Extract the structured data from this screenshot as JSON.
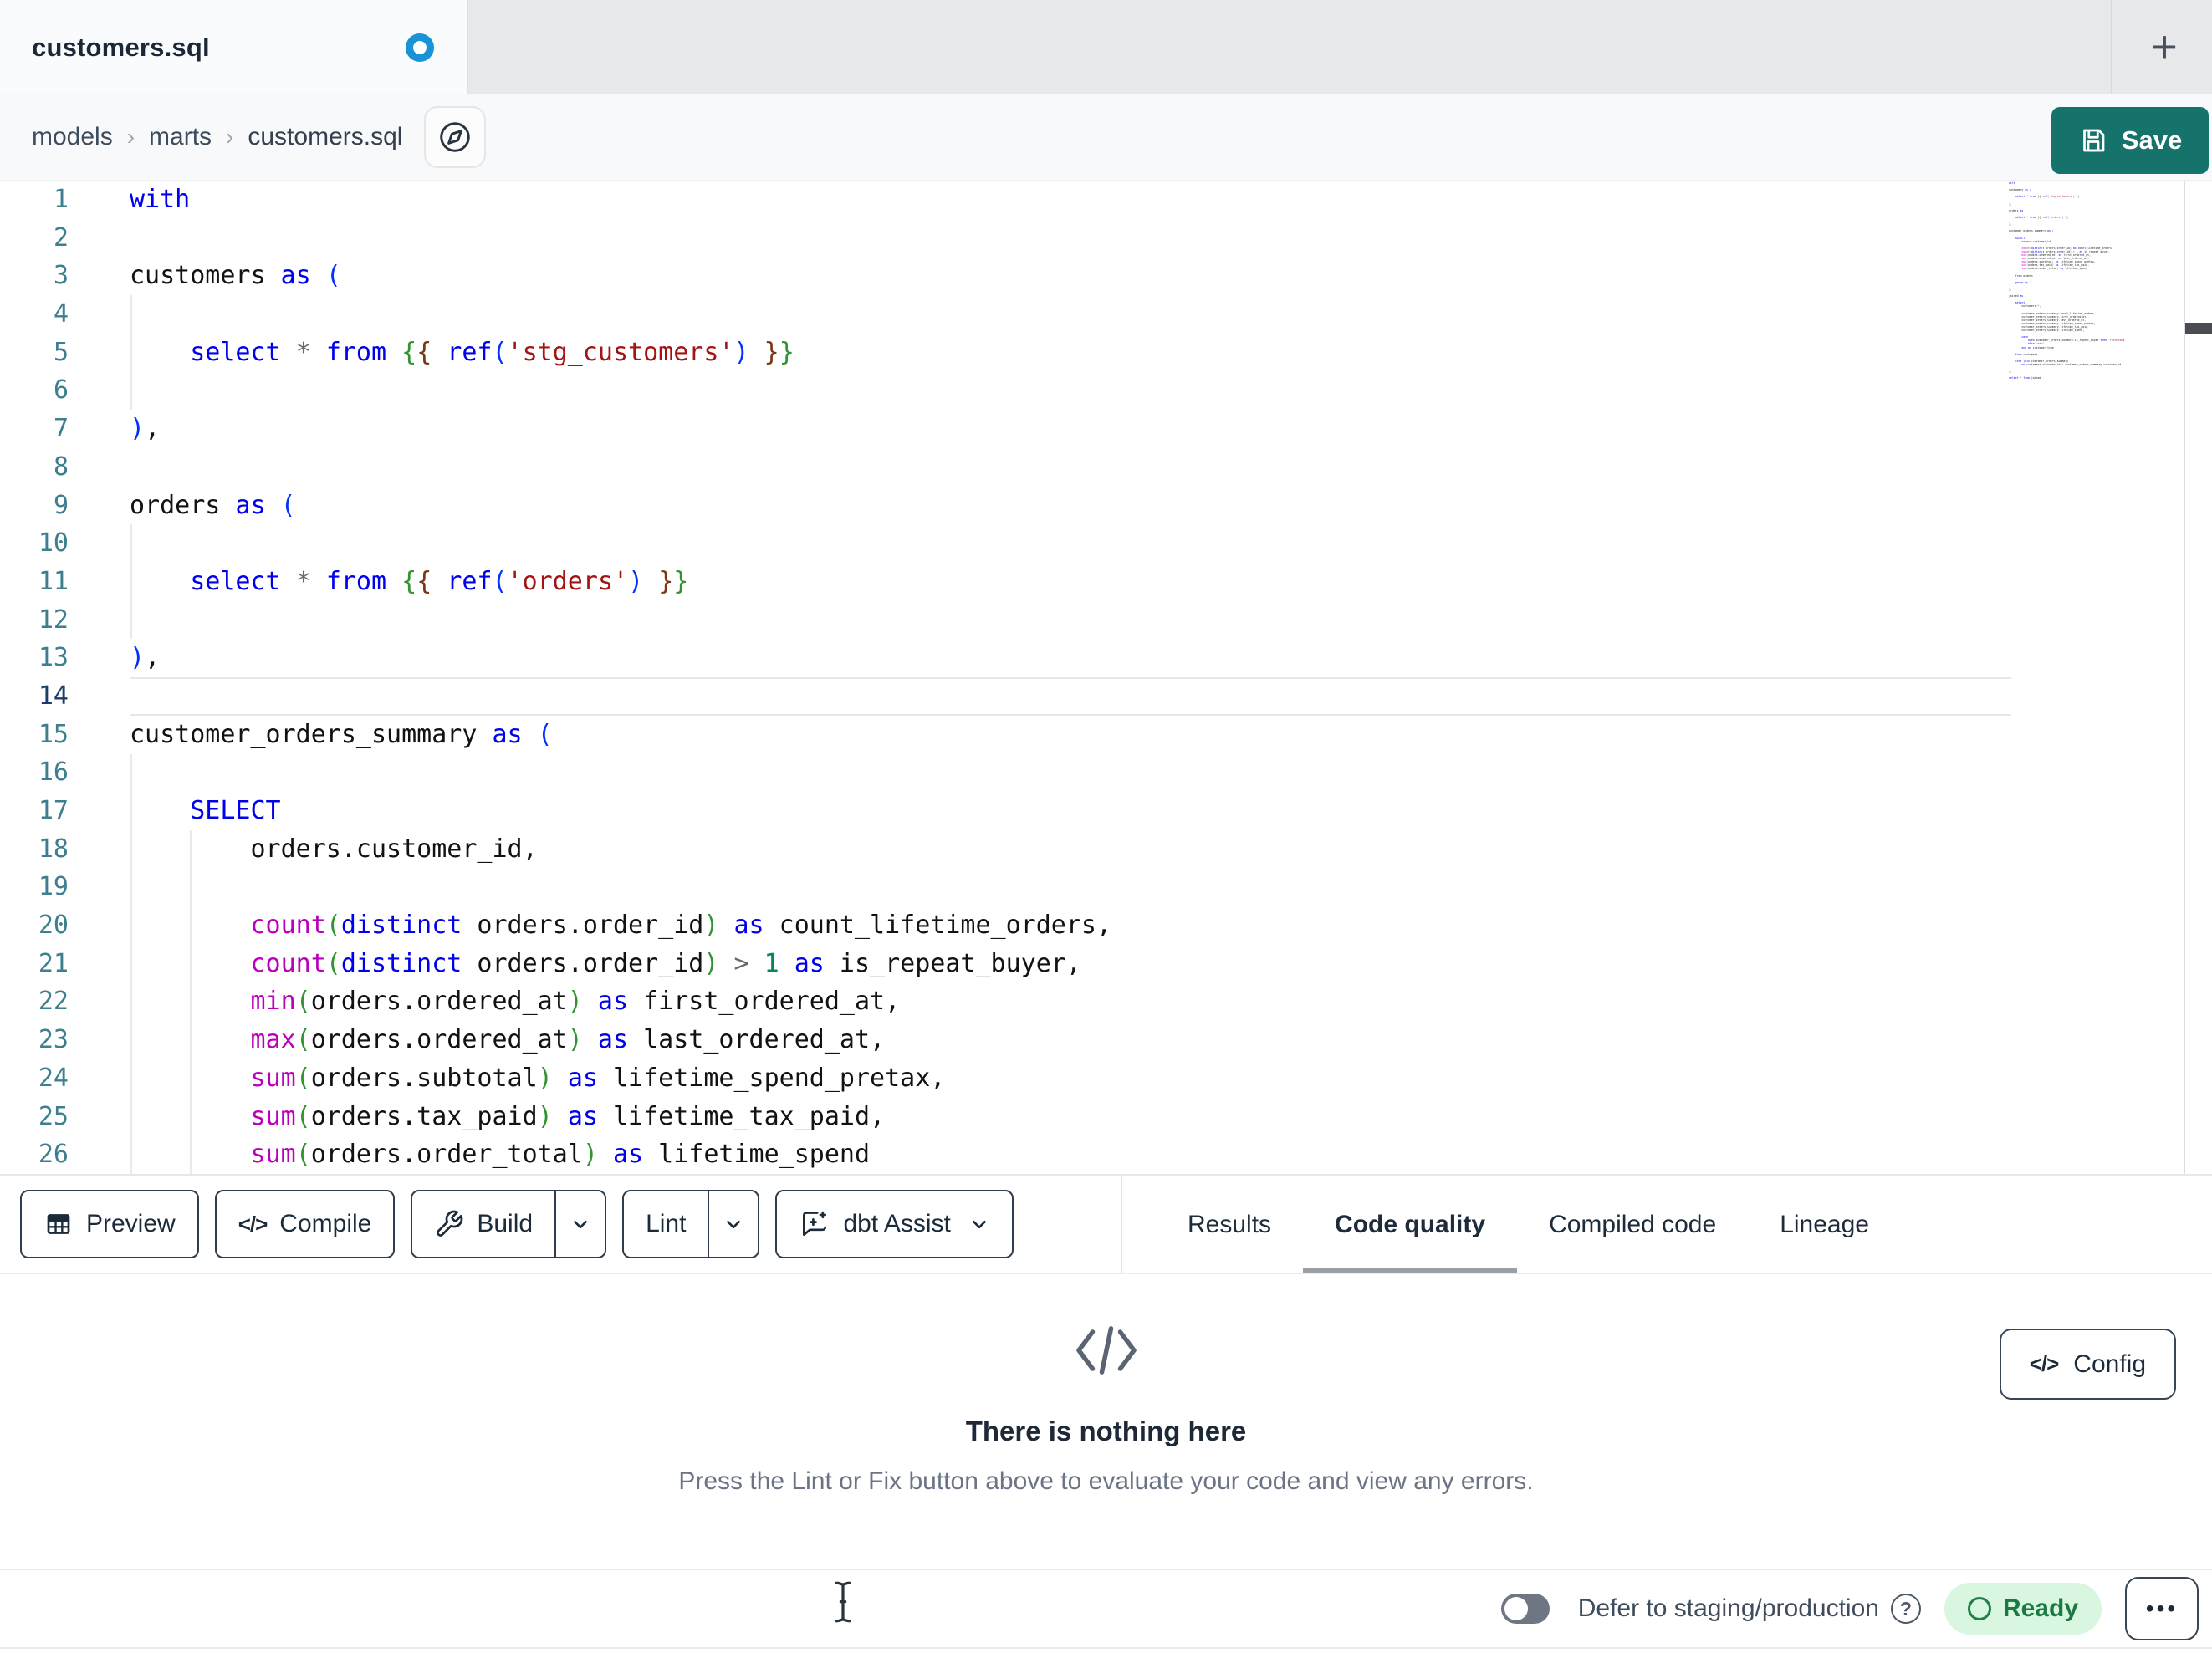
{
  "tab_bar": {
    "active_tab_label": "customers.sql",
    "new_tab_glyph": "+",
    "unsaved_indicator": "unsaved-changes"
  },
  "breadcrumb": {
    "items": [
      "models",
      "marts",
      "customers.sql"
    ],
    "separator": "›"
  },
  "save_button": {
    "label": "Save"
  },
  "editor": {
    "language": "sql",
    "active_line": 14,
    "code_lines": [
      "with",
      "",
      "customers as (",
      "",
      "    select * from {{ ref('stg_customers') }}",
      "",
      "),",
      "",
      "orders as (",
      "",
      "    select * from {{ ref('orders') }}",
      "",
      "),",
      "",
      "customer_orders_summary as (",
      "",
      "    SELECT",
      "        orders.customer_id,",
      "",
      "        count(distinct orders.order_id) as count_lifetime_orders,",
      "        count(distinct orders.order_id) > 1 as is_repeat_buyer,",
      "        min(orders.ordered_at) as first_ordered_at,",
      "        max(orders.ordered_at) as last_ordered_at,",
      "        sum(orders.subtotal) as lifetime_spend_pretax,",
      "        sum(orders.tax_paid) as lifetime_tax_paid,",
      "        sum(orders.order_total) as lifetime_spend"
    ],
    "minimap_lines": [
      "with",
      "",
      "customers as (",
      "",
      "    select * from {{ ref('stg_customers') }}",
      "",
      "),",
      "",
      "orders as (",
      "",
      "    select * from {{ ref('orders') }}",
      "",
      "),",
      "",
      "customer_orders_summary as (",
      "",
      "    SELECT",
      "        orders.customer_id,",
      "",
      "        count(distinct orders.order_id) as count_lifetime_orders,",
      "        count(distinct orders.order_id) > 1 as is_repeat_buyer,",
      "        min(orders.ordered_at) as first_ordered_at,",
      "        max(orders.ordered_at) as last_ordered_at,",
      "        sum(orders.subtotal) as lifetime_spend_pretax,",
      "        sum(orders.tax_paid) as lifetime_tax_paid,",
      "        sum(orders.order_total) as lifetime_spend",
      "",
      "    from orders",
      "",
      "    group by 1",
      "",
      "),",
      "",
      "joined as (",
      "",
      "    select",
      "        customers.*,",
      "",
      "        customer_orders_summary.count_lifetime_orders,",
      "        customer_orders_summary.first_ordered_at,",
      "        customer_orders_summary.last_ordered_at,",
      "        customer_orders_summary.lifetime_spend_pretax,",
      "        customer_orders_summary.lifetime_tax_paid,",
      "        customer_orders_summary.lifetime_spend,",
      "",
      "        case",
      "            when customer_orders_summary.is_repeat_buyer then 'returning'",
      "            else 'new'",
      "        end as customer_type",
      "",
      "    from customers",
      "",
      "    left join customer_orders_summary",
      "        on customers.customer_id = customer_orders_summary.customer_id",
      "",
      "),",
      "",
      "select * from joined"
    ]
  },
  "toolbar": {
    "preview_label": "Preview",
    "compile_label": "Compile",
    "build_label": "Build",
    "lint_label": "Lint",
    "assist_label": "dbt Assist",
    "compile_icon_glyph": "</>"
  },
  "panel": {
    "tabs": [
      {
        "label": "Results"
      },
      {
        "label": "Code quality"
      },
      {
        "label": "Compiled code"
      },
      {
        "label": "Lineage"
      }
    ],
    "active_tab": "Code quality",
    "empty_state": {
      "title": "There is nothing here",
      "description": "Press the Lint or Fix button above to evaluate your code and view any errors."
    },
    "config_button": {
      "label": "Config",
      "icon_glyph": "</>"
    }
  },
  "status_bar": {
    "defer_toggle": {
      "label": "Defer to staging/production",
      "state": "off"
    },
    "ready_badge": {
      "label": "Ready"
    },
    "overflow_menu_glyph": "•••"
  },
  "colors": {
    "accent_teal": "#16736C",
    "unsaved_dot_blue": "#1793D6",
    "ready_badge_bg": "#D9F6E0",
    "ready_badge_text": "#1A7A41",
    "syntax_keyword": "#0000EE",
    "syntax_function": "#BB00BB",
    "syntax_string": "#A31515",
    "syntax_number": "#098658",
    "bracket_level_1": "#0431FA",
    "bracket_level_2": "#319331",
    "bracket_level_3": "#7B3814",
    "line_number": "#3E7F8F",
    "active_line_number": "#1C3D6B"
  }
}
